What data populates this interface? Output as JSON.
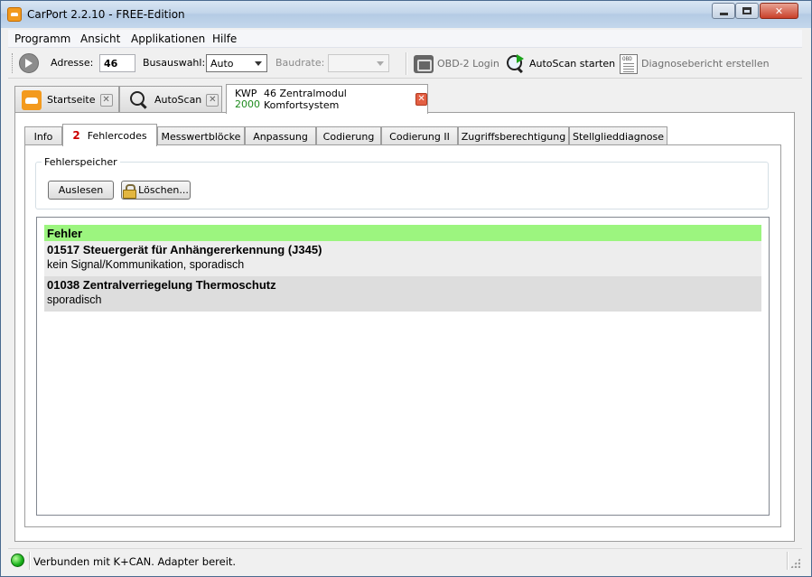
{
  "window": {
    "title": "CarPort 2.2.10  - FREE-Edition"
  },
  "menu": [
    "Programm",
    "Ansicht",
    "Applikationen",
    "Hilfe"
  ],
  "toolbar": {
    "adresse_label": "Adresse:",
    "adresse_value": "46",
    "busauswahl_label": "Busauswahl:",
    "busauswahl_value": "Auto",
    "baudrate_label": "Baudrate:",
    "baudrate_value": "",
    "obd_login": "OBD-2 Login",
    "autoscan_start": "AutoScan starten",
    "report": "Diagnosebericht erstellen",
    "report_icon_text": "OBD"
  },
  "main_tabs": {
    "startseite": "Startseite",
    "autoscan": "AutoScan",
    "module": {
      "protocol": "KWP",
      "protocol_num": "2000",
      "label": "46 Zentralmodul Komfortsystem"
    }
  },
  "sub_tabs": {
    "info": "Info",
    "fehlercodes_count": "2",
    "fehlercodes": "Fehlercodes",
    "messwertbloecke": "Messwertblöcke",
    "anpassung": "Anpassung",
    "codierung": "Codierung",
    "codierung2": "Codierung II",
    "zugriff": "Zugriffsberechtigung",
    "stellglied": "Stellglieddiagnose"
  },
  "fehlerspeicher": {
    "title": "Fehlerspeicher",
    "auslesen": "Auslesen",
    "loeschen": "Löschen..."
  },
  "faults": {
    "header": "Fehler",
    "items": [
      {
        "title": "01517 Steuergerät für Anhängererkennung (J345)",
        "desc": "kein Signal/Kommunikation, sporadisch"
      },
      {
        "title": "01038 Zentralverriegelung Thermoschutz",
        "desc": "sporadisch"
      }
    ]
  },
  "status": {
    "text": "Verbunden mit K+CAN. Adapter bereit."
  },
  "colors": {
    "fault_header_bg": "#9cf57f",
    "fault_count": "#cc0000",
    "kwp_num": "#1e8b1e",
    "accent_orange": "#f39a1e"
  }
}
